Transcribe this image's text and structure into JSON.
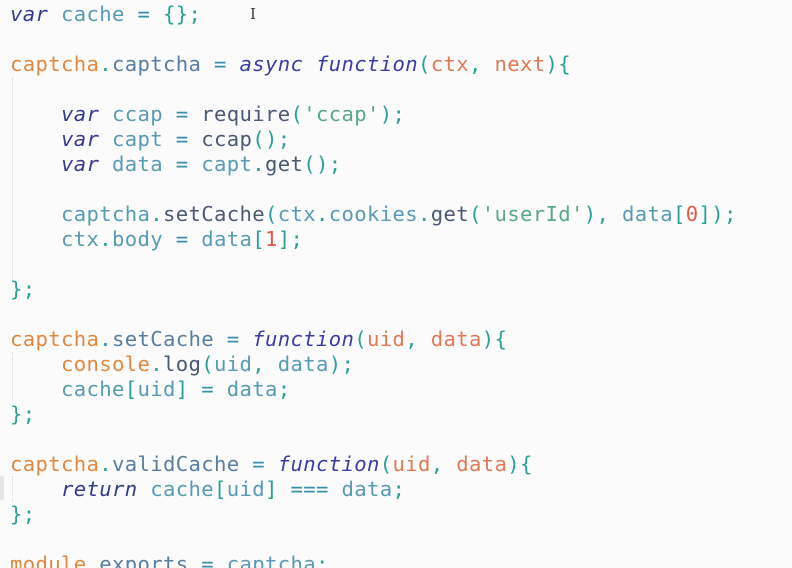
{
  "editor": {
    "language": "javascript",
    "cursor_glyph": "I",
    "lines": [
      {
        "tokens": [
          {
            "t": "var",
            "c": "kw"
          },
          {
            "t": " "
          },
          {
            "t": "cache",
            "c": "var"
          },
          {
            "t": " "
          },
          {
            "t": "=",
            "c": "op"
          },
          {
            "t": " "
          },
          {
            "t": "{};",
            "c": "punc"
          }
        ]
      },
      {
        "tokens": []
      },
      {
        "tokens": [
          {
            "t": "captcha",
            "c": "obj"
          },
          {
            "t": ".",
            "c": "punc"
          },
          {
            "t": "captcha",
            "c": "prop"
          },
          {
            "t": " "
          },
          {
            "t": "=",
            "c": "op"
          },
          {
            "t": " "
          },
          {
            "t": "async",
            "c": "fn"
          },
          {
            "t": " "
          },
          {
            "t": "function",
            "c": "fn"
          },
          {
            "t": "(",
            "c": "punc"
          },
          {
            "t": "ctx",
            "c": "param"
          },
          {
            "t": ", ",
            "c": "punc"
          },
          {
            "t": "next",
            "c": "param"
          },
          {
            "t": "){",
            "c": "punc"
          }
        ]
      },
      {
        "tokens": []
      },
      {
        "tokens": [
          {
            "t": "    "
          },
          {
            "t": "var",
            "c": "kw"
          },
          {
            "t": " "
          },
          {
            "t": "ccap",
            "c": "var"
          },
          {
            "t": " "
          },
          {
            "t": "=",
            "c": "op"
          },
          {
            "t": " "
          },
          {
            "t": "require",
            "c": "call"
          },
          {
            "t": "(",
            "c": "punc"
          },
          {
            "t": "'ccap'",
            "c": "str"
          },
          {
            "t": ");",
            "c": "punc"
          }
        ]
      },
      {
        "tokens": [
          {
            "t": "    "
          },
          {
            "t": "var",
            "c": "kw"
          },
          {
            "t": " "
          },
          {
            "t": "capt",
            "c": "var"
          },
          {
            "t": " "
          },
          {
            "t": "=",
            "c": "op"
          },
          {
            "t": " "
          },
          {
            "t": "ccap",
            "c": "call"
          },
          {
            "t": "();",
            "c": "punc"
          }
        ]
      },
      {
        "tokens": [
          {
            "t": "    "
          },
          {
            "t": "var",
            "c": "kw"
          },
          {
            "t": " "
          },
          {
            "t": "data",
            "c": "var"
          },
          {
            "t": " "
          },
          {
            "t": "=",
            "c": "op"
          },
          {
            "t": " "
          },
          {
            "t": "capt",
            "c": "var"
          },
          {
            "t": ".",
            "c": "punc"
          },
          {
            "t": "get",
            "c": "call"
          },
          {
            "t": "();",
            "c": "punc"
          }
        ]
      },
      {
        "tokens": []
      },
      {
        "tokens": [
          {
            "t": "    "
          },
          {
            "t": "captcha",
            "c": "var"
          },
          {
            "t": ".",
            "c": "punc"
          },
          {
            "t": "setCache",
            "c": "call"
          },
          {
            "t": "(",
            "c": "punc"
          },
          {
            "t": "ctx",
            "c": "var"
          },
          {
            "t": ".",
            "c": "punc"
          },
          {
            "t": "cookies",
            "c": "var"
          },
          {
            "t": ".",
            "c": "punc"
          },
          {
            "t": "get",
            "c": "call"
          },
          {
            "t": "(",
            "c": "punc"
          },
          {
            "t": "'userId'",
            "c": "str"
          },
          {
            "t": "), ",
            "c": "punc"
          },
          {
            "t": "data",
            "c": "var"
          },
          {
            "t": "[",
            "c": "punc"
          },
          {
            "t": "0",
            "c": "num"
          },
          {
            "t": "]);",
            "c": "punc"
          }
        ]
      },
      {
        "tokens": [
          {
            "t": "    "
          },
          {
            "t": "ctx",
            "c": "var"
          },
          {
            "t": ".",
            "c": "punc"
          },
          {
            "t": "body",
            "c": "var"
          },
          {
            "t": " "
          },
          {
            "t": "=",
            "c": "op"
          },
          {
            "t": " "
          },
          {
            "t": "data",
            "c": "var"
          },
          {
            "t": "[",
            "c": "punc"
          },
          {
            "t": "1",
            "c": "num"
          },
          {
            "t": "];",
            "c": "punc"
          }
        ]
      },
      {
        "tokens": []
      },
      {
        "tokens": [
          {
            "t": "};",
            "c": "punc"
          }
        ]
      },
      {
        "tokens": []
      },
      {
        "tokens": [
          {
            "t": "captcha",
            "c": "obj"
          },
          {
            "t": ".",
            "c": "punc"
          },
          {
            "t": "setCache",
            "c": "prop"
          },
          {
            "t": " "
          },
          {
            "t": "=",
            "c": "op"
          },
          {
            "t": " "
          },
          {
            "t": "function",
            "c": "fn"
          },
          {
            "t": "(",
            "c": "punc"
          },
          {
            "t": "uid",
            "c": "param"
          },
          {
            "t": ", ",
            "c": "punc"
          },
          {
            "t": "data",
            "c": "param"
          },
          {
            "t": "){",
            "c": "punc"
          }
        ]
      },
      {
        "tokens": [
          {
            "t": "    "
          },
          {
            "t": "console",
            "c": "obj"
          },
          {
            "t": ".",
            "c": "punc"
          },
          {
            "t": "log",
            "c": "call"
          },
          {
            "t": "(",
            "c": "punc"
          },
          {
            "t": "uid",
            "c": "var"
          },
          {
            "t": ", ",
            "c": "punc"
          },
          {
            "t": "data",
            "c": "var"
          },
          {
            "t": ");",
            "c": "punc"
          }
        ]
      },
      {
        "tokens": [
          {
            "t": "    "
          },
          {
            "t": "cache",
            "c": "var"
          },
          {
            "t": "[",
            "c": "punc"
          },
          {
            "t": "uid",
            "c": "var"
          },
          {
            "t": "]",
            "c": "punc"
          },
          {
            "t": " "
          },
          {
            "t": "=",
            "c": "op"
          },
          {
            "t": " "
          },
          {
            "t": "data",
            "c": "var"
          },
          {
            "t": ";",
            "c": "punc"
          }
        ]
      },
      {
        "tokens": [
          {
            "t": "};",
            "c": "punc"
          }
        ]
      },
      {
        "tokens": []
      },
      {
        "tokens": [
          {
            "t": "captcha",
            "c": "obj"
          },
          {
            "t": ".",
            "c": "punc"
          },
          {
            "t": "validCache",
            "c": "prop"
          },
          {
            "t": " "
          },
          {
            "t": "=",
            "c": "op"
          },
          {
            "t": " "
          },
          {
            "t": "function",
            "c": "fn"
          },
          {
            "t": "(",
            "c": "punc"
          },
          {
            "t": "uid",
            "c": "param"
          },
          {
            "t": ", ",
            "c": "punc"
          },
          {
            "t": "data",
            "c": "param"
          },
          {
            "t": "){",
            "c": "punc"
          }
        ]
      },
      {
        "tokens": [
          {
            "t": "    "
          },
          {
            "t": "return",
            "c": "kw"
          },
          {
            "t": " "
          },
          {
            "t": "cache",
            "c": "var"
          },
          {
            "t": "[",
            "c": "punc"
          },
          {
            "t": "uid",
            "c": "var"
          },
          {
            "t": "]",
            "c": "punc"
          },
          {
            "t": " "
          },
          {
            "t": "===",
            "c": "op"
          },
          {
            "t": " "
          },
          {
            "t": "data",
            "c": "var"
          },
          {
            "t": ";",
            "c": "punc"
          }
        ]
      },
      {
        "tokens": [
          {
            "t": "};",
            "c": "punc"
          }
        ]
      },
      {
        "tokens": []
      },
      {
        "tokens": [
          {
            "t": "module",
            "c": "obj"
          },
          {
            "t": ".",
            "c": "punc"
          },
          {
            "t": "exports",
            "c": "prop"
          },
          {
            "t": " "
          },
          {
            "t": "=",
            "c": "op"
          },
          {
            "t": " "
          },
          {
            "t": "captcha",
            "c": "var"
          },
          {
            "t": ";",
            "c": "punc"
          }
        ]
      }
    ]
  }
}
